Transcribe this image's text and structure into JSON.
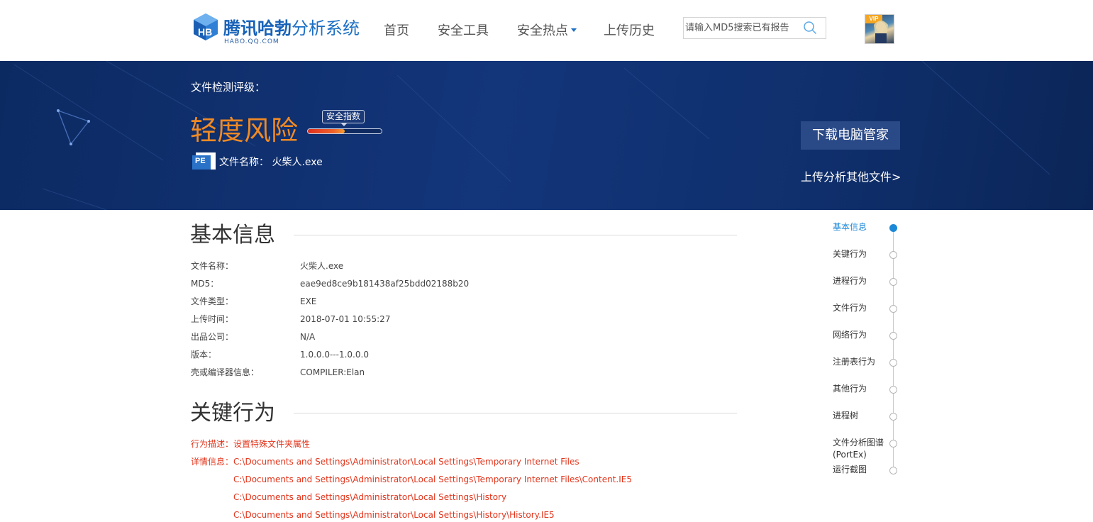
{
  "header": {
    "logo": {
      "title_bold": "腾讯哈勃",
      "title_rest": "分析系统",
      "subtitle": "HABO.QQ.COM"
    },
    "nav": [
      {
        "label": "首页",
        "dropdown": false
      },
      {
        "label": "安全工具",
        "dropdown": false
      },
      {
        "label": "安全热点",
        "dropdown": true
      },
      {
        "label": "上传历史",
        "dropdown": false
      }
    ],
    "search": {
      "placeholder": "请输入MD5搜索已有报告",
      "value": ""
    },
    "avatar": {
      "badge": "VIP"
    }
  },
  "banner": {
    "rating_label": "文件检测评级：",
    "risk_level": "轻度风险",
    "safety_tag": "安全指数",
    "safety_level": 0.5,
    "file_label": "文件名称：",
    "file_name": "火柴人.exe",
    "file_icon_text": "PE",
    "download_button": "下载电脑管家",
    "upload_link": "上传分析其他文件>"
  },
  "basic_info": {
    "title": "基本信息",
    "rows": [
      {
        "key": "文件名称：",
        "value": "火柴人.exe"
      },
      {
        "key": "MD5：",
        "value": "eae9ed8ce9b181438af25bdd02188b20"
      },
      {
        "key": "文件类型：",
        "value": "EXE"
      },
      {
        "key": "上传时间：",
        "value": "2018-07-01 10:55:27"
      },
      {
        "key": "出品公司：",
        "value": "N/A"
      },
      {
        "key": "版本：",
        "value": "1.0.0.0---1.0.0.0"
      },
      {
        "key": "壳或编译器信息：",
        "value": "COMPILER:Elan"
      }
    ]
  },
  "key_behavior": {
    "title": "关键行为",
    "description_label": "行为描述：",
    "description": "设置特殊文件夹属性",
    "detail_label": "详情信息：",
    "details": [
      "C:\\Documents and Settings\\Administrator\\Local Settings\\Temporary Internet Files",
      "C:\\Documents and Settings\\Administrator\\Local Settings\\Temporary Internet Files\\Content.IE5",
      "C:\\Documents and Settings\\Administrator\\Local Settings\\History",
      "C:\\Documents and Settings\\Administrator\\Local Settings\\History\\History.IE5"
    ]
  },
  "side_nav": {
    "items": [
      {
        "label": "基本信息",
        "active": true
      },
      {
        "label": "关键行为",
        "active": false
      },
      {
        "label": "进程行为",
        "active": false
      },
      {
        "label": "文件行为",
        "active": false
      },
      {
        "label": "网络行为",
        "active": false
      },
      {
        "label": "注册表行为",
        "active": false
      },
      {
        "label": "其他行为",
        "active": false
      },
      {
        "label": "进程树",
        "active": false
      },
      {
        "label": "文件分析图谱",
        "label_line2": "(PortEx)",
        "active": false
      },
      {
        "label": "运行截图",
        "active": false
      }
    ]
  },
  "colors": {
    "brand_blue": "#1c6fc4",
    "banner_bg": "#102f6e",
    "risk_orange": "#f08a24",
    "behavior_red": "#e2351c",
    "active_blue": "#1c88d8"
  },
  "icons": [
    "habo-logo-icon",
    "search-icon",
    "pe-file-icon",
    "chevron-down-icon"
  ]
}
